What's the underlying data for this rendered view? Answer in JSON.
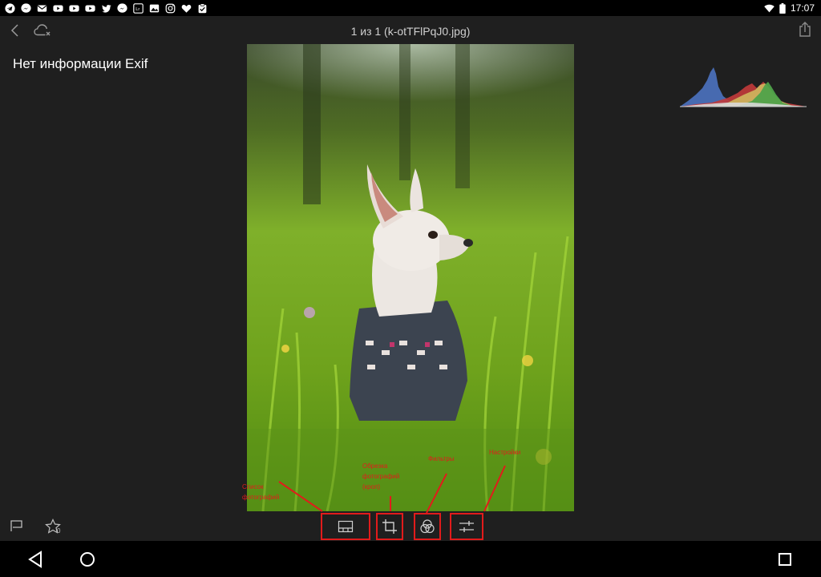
{
  "status_bar": {
    "left_icons": [
      "telegram-icon",
      "messenger-icon",
      "mail-icon",
      "youtube-icon",
      "youtube-icon",
      "youtube-icon",
      "twitter-icon",
      "messenger-icon",
      "lightroom-icon",
      "image-icon",
      "instagram-icon",
      "heart-icon",
      "clipboard-check-icon"
    ],
    "time": "17:07"
  },
  "header": {
    "title": "1 из 1 (k-otTFlPqJ0.jpg)"
  },
  "info": {
    "exif_text": "Нет информации Exif"
  },
  "rating": {
    "star_count": "0"
  },
  "annotations": {
    "filmstrip": "Список фотографий",
    "crop_line1": "Обрезка",
    "crop_line2": "фотографий",
    "crop_line3": "(кроп)",
    "filters": "Фильтры",
    "settings": "Настройки"
  },
  "colors": {
    "annotation_red": "#e21b1b",
    "app_background": "#1f1f1f"
  }
}
